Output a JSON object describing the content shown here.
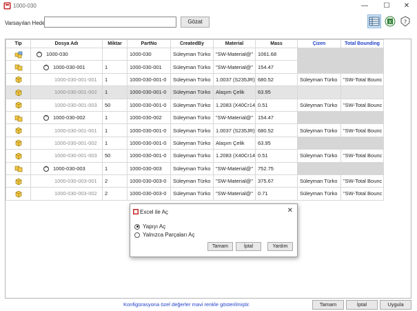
{
  "window": {
    "title": "1000-030",
    "minimize": "—",
    "maximize": "☐",
    "close": "✕"
  },
  "toolbar": {
    "target_label": "Varsayılan Hedef:",
    "target_value": "",
    "browse_label": "Gözat",
    "icons": [
      "grid-view-icon",
      "excel-export-icon",
      "help-icon"
    ]
  },
  "table": {
    "columns": [
      {
        "key": "tip",
        "label": "Tip",
        "custom": false
      },
      {
        "key": "name",
        "label": "Dosya Adı",
        "custom": false
      },
      {
        "key": "qty",
        "label": "Miktar",
        "custom": false
      },
      {
        "key": "partno",
        "label": "PartNo",
        "custom": false
      },
      {
        "key": "createdby",
        "label": "CreatedBy",
        "custom": false
      },
      {
        "key": "material",
        "label": "Material",
        "custom": false
      },
      {
        "key": "mass",
        "label": "Mass",
        "custom": false
      },
      {
        "key": "cizen",
        "label": "Çizen",
        "custom": true
      },
      {
        "key": "bounding",
        "label": "Total Bounding",
        "custom": true
      }
    ],
    "rows": [
      {
        "icon": "assembly",
        "level": 1,
        "toggle": "^",
        "ref": false,
        "name": "1000-030",
        "qty": "",
        "partno": "1000-030",
        "createdby": "Süleyman Türko",
        "material": "\"SW-Material@\"",
        "mass": "1061.68",
        "cizen": "",
        "bounding": "",
        "gray": [
          "cizen",
          "bounding"
        ]
      },
      {
        "icon": "subassembly",
        "level": 2,
        "toggle": "^",
        "ref": false,
        "name": "1000-030-001",
        "qty": "1",
        "partno": "1000-030-001",
        "createdby": "Süleyman Türko",
        "material": "\"SW-Material@\"",
        "mass": "154.47",
        "cizen": "",
        "bounding": "",
        "gray": [
          "cizen",
          "bounding"
        ]
      },
      {
        "icon": "part",
        "level": 3,
        "toggle": "",
        "ref": true,
        "name": "1000-030-001-001",
        "qty": "1",
        "partno": "1000-030-001-0",
        "createdby": "Süleyman Türko",
        "material": "1.0037 (S235JR)",
        "mass": "680.52",
        "cizen": "Süleyman Türko",
        "bounding": "\"SW-Total Bounc",
        "gray": []
      },
      {
        "icon": "part",
        "level": 3,
        "toggle": "",
        "ref": true,
        "selected": true,
        "name": "1000-030-001-002",
        "qty": "1",
        "partno": "1000-030-001-0",
        "createdby": "Süleyman Türko",
        "material": "Alaşım Çelik",
        "mass": "63.95",
        "cizen": "",
        "bounding": "",
        "gray": [
          "cizen",
          "bounding"
        ]
      },
      {
        "icon": "part",
        "level": 3,
        "toggle": "",
        "ref": true,
        "name": "1000-030-001-003",
        "qty": "50",
        "partno": "1000-030-001-0",
        "createdby": "Süleyman Türko",
        "material": "1.2083 (X40Cr14",
        "mass": "0.51",
        "cizen": "Süleyman Türko",
        "bounding": "\"SW-Total Bounc",
        "gray": []
      },
      {
        "icon": "subassembly",
        "level": 2,
        "toggle": "^",
        "ref": false,
        "name": "1000-030-002",
        "qty": "1",
        "partno": "1000-030-002",
        "createdby": "Süleyman Türko",
        "material": "\"SW-Material@\"",
        "mass": "154.47",
        "cizen": "",
        "bounding": "",
        "gray": [
          "cizen",
          "bounding"
        ]
      },
      {
        "icon": "part",
        "level": 3,
        "toggle": "",
        "ref": true,
        "name": "1000-030-001-001",
        "qty": "1",
        "partno": "1000-030-001-0",
        "createdby": "Süleyman Türko",
        "material": "1.0037 (S235JR)",
        "mass": "680.52",
        "cizen": "Süleyman Türko",
        "bounding": "\"SW-Total Bounc",
        "gray": []
      },
      {
        "icon": "part",
        "level": 3,
        "toggle": "",
        "ref": true,
        "name": "1000-030-001-002",
        "qty": "1",
        "partno": "1000-030-001-0",
        "createdby": "Süleyman Türko",
        "material": "Alaşım Çelik",
        "mass": "63.95",
        "cizen": "",
        "bounding": "",
        "gray": [
          "cizen",
          "bounding"
        ]
      },
      {
        "icon": "part",
        "level": 3,
        "toggle": "",
        "ref": true,
        "name": "1000-030-001-003",
        "qty": "50",
        "partno": "1000-030-001-0",
        "createdby": "Süleyman Türko",
        "material": "1.2083 (X40Cr14",
        "mass": "0.51",
        "cizen": "Süleyman Türko",
        "bounding": "\"SW-Total Bounc",
        "gray": []
      },
      {
        "icon": "subassembly",
        "level": 2,
        "toggle": "^",
        "ref": false,
        "name": "1000-030-003",
        "qty": "1",
        "partno": "1000-030-003",
        "createdby": "Süleyman Türko",
        "material": "\"SW-Material@\"",
        "mass": "752.75",
        "cizen": "",
        "bounding": "",
        "gray": [
          "cizen",
          "bounding"
        ]
      },
      {
        "icon": "part",
        "level": 3,
        "toggle": "",
        "ref": true,
        "name": "1000-030-003-001",
        "qty": "2",
        "partno": "1000-030-003-0",
        "createdby": "Süleyman Türko",
        "material": "\"SW-Material@\"",
        "mass": "375.67",
        "cizen": "Süleyman Türko",
        "bounding": "\"SW-Total Bounc",
        "gray": []
      },
      {
        "icon": "part",
        "level": 3,
        "toggle": "",
        "ref": true,
        "name": "1000-030-003-002",
        "qty": "2",
        "partno": "1000-030-003-0",
        "createdby": "Süleyman Türko",
        "material": "\"SW-Material@\"",
        "mass": "0.71",
        "cizen": "Süleyman Türko",
        "bounding": "\"SW-Total Bounc",
        "gray": []
      }
    ]
  },
  "dialog": {
    "title": "Excel ile Aç",
    "close": "✕",
    "options": [
      {
        "label": "Yapıyı Aç",
        "checked": true
      },
      {
        "label": "Yalnızca Parçaları Aç",
        "checked": false
      }
    ],
    "ok_label": "Tamam",
    "cancel_label": "İptal",
    "help_label": "Yardım"
  },
  "footer": {
    "note": "Konfigürasyona özel değerler mavi renkle gösterilmiştir.",
    "ok_label": "Tamam",
    "cancel_label": "İptal",
    "apply_label": "Uygula"
  },
  "colors": {
    "custom_header": "#1e3fc9",
    "gray_cell": "#d6d6d6",
    "selected_row": "#e4e4e4"
  }
}
